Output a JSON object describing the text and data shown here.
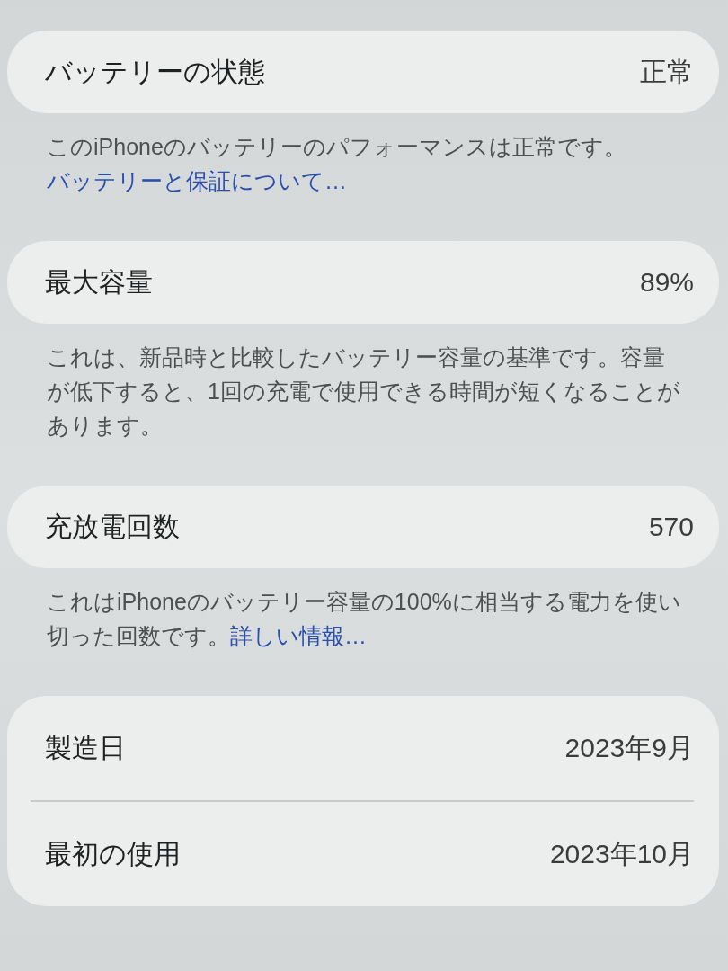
{
  "sections": [
    {
      "rows": [
        {
          "label": "バッテリーの状態",
          "value": "正常"
        }
      ],
      "footer": {
        "text": "このiPhoneのバッテリーのパフォーマンスは正常です。",
        "link": "バッテリーと保証について…"
      }
    },
    {
      "rows": [
        {
          "label": "最大容量",
          "value": "89%"
        }
      ],
      "footer": {
        "text": "これは、新品時と比較したバッテリー容量の基準です。容量が低下すると、1回の充電で使用できる時間が短くなることがあります。"
      }
    },
    {
      "rows": [
        {
          "label": "充放電回数",
          "value": "570"
        }
      ],
      "footer": {
        "text": "これはiPhoneのバッテリー容量の100%に相当する電力を使い切った回数です。",
        "link": "詳しい情報…"
      }
    },
    {
      "rows": [
        {
          "label": "製造日",
          "value": "2023年9月"
        },
        {
          "label": "最初の使用",
          "value": "2023年10月"
        }
      ]
    }
  ]
}
